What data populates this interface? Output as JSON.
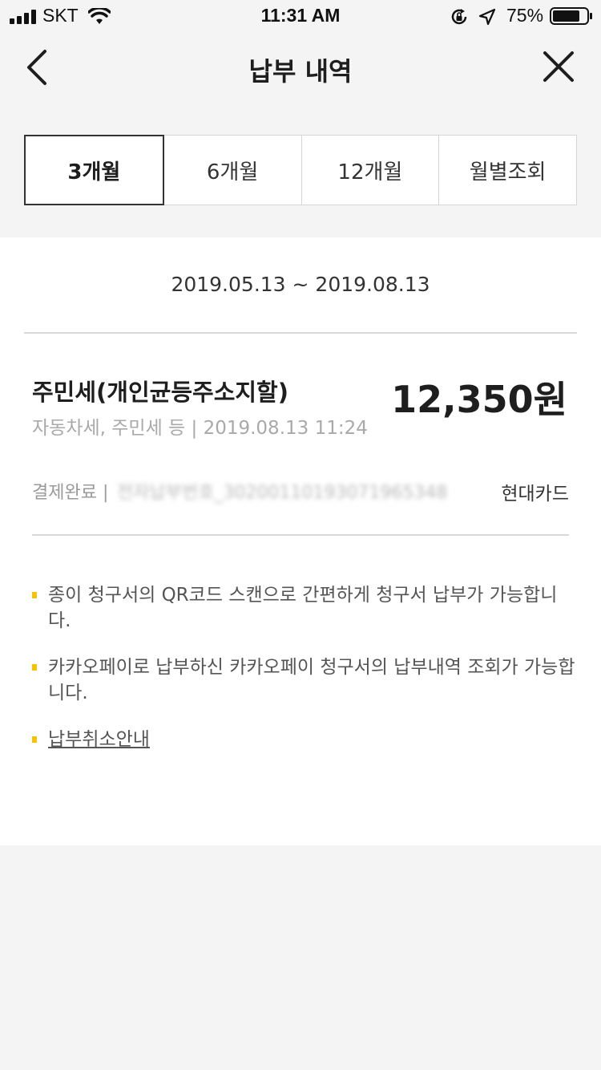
{
  "status_bar": {
    "carrier": "SKT",
    "time": "11:31 AM",
    "battery": "75%"
  },
  "header": {
    "title": "납부 내역"
  },
  "tabs": [
    {
      "label": "3개월",
      "active": true
    },
    {
      "label": "6개월",
      "active": false
    },
    {
      "label": "12개월",
      "active": false
    },
    {
      "label": "월별조회",
      "active": false
    }
  ],
  "content": {
    "date_range": "2019.05.13 ~ 2019.08.13",
    "item": {
      "title": "주민세(개인균등주소지할)",
      "subtitle": "자동차세, 주민세 등 | 2019.08.13 11:24",
      "amount": "12,350원",
      "status": "결제완료 |",
      "reference": "전자납부번호_30200110193071965348",
      "card": "현대카드"
    },
    "notes": [
      "종이 청구서의 QR코드 스캔으로 간편하게 청구서 납부가 가능합니다.",
      "카카오페이로 납부하신 카카오페이 청구서의 납부내역 조회가 가능합니다.",
      "납부취소안내"
    ]
  },
  "colors": {
    "accent": "#f5c400",
    "background": "#f4f4f4"
  }
}
